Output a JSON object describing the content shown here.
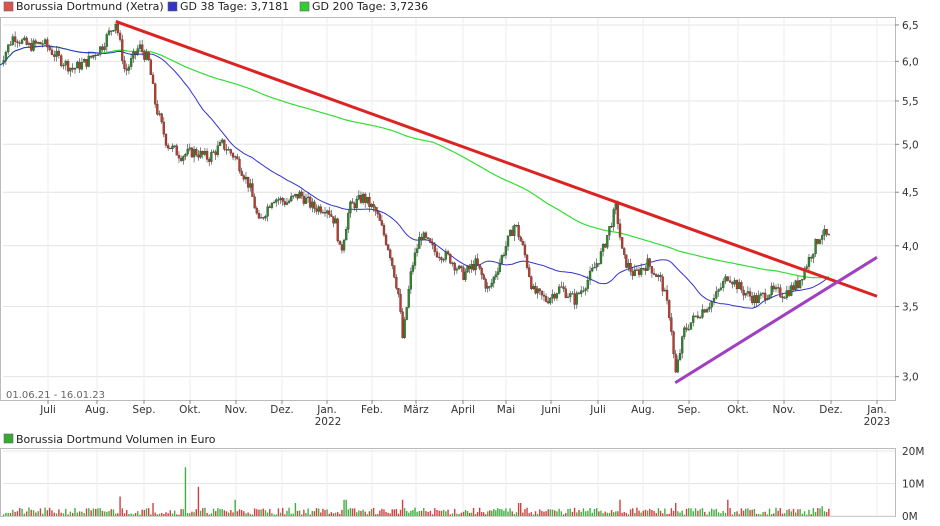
{
  "chart_data": [
    {
      "type": "candlestick",
      "legend": [
        {
          "name": "Borussia Dortmund (Xetra)",
          "color": "#d9534f"
        },
        {
          "name": "GD 38 Tage: 3,7181",
          "color": "#3333cc"
        },
        {
          "name": "GD 200 Tage: 3,7236",
          "color": "#33cc33"
        }
      ],
      "date_range_label": "01.06.21 - 16.01.23",
      "x_tick_labels": [
        "Juli",
        "Aug.",
        "Sep.",
        "Okt.",
        "Nov.",
        "Dez.",
        "Jan.",
        "Feb.",
        "März",
        "April",
        "Mai",
        "Juni",
        "Juli",
        "Aug.",
        "Sep.",
        "Okt.",
        "Nov.",
        "Dez.",
        "Jan."
      ],
      "year_labels": [
        "2022",
        "2023"
      ],
      "y_tick_labels": [
        "3,0",
        "3,5",
        "4,0",
        "4,5",
        "5,0",
        "5,5",
        "6,0",
        "6,5"
      ],
      "y_ticks": [
        3.0,
        3.5,
        4.0,
        4.5,
        5.0,
        5.5,
        6.0,
        6.5
      ],
      "ylim": [
        2.85,
        6.6
      ],
      "y_scale": "log",
      "price_series": [
        {
          "month": 0.0,
          "close": 5.95
        },
        {
          "month": 0.3,
          "close": 6.35
        },
        {
          "month": 0.6,
          "close": 6.2
        },
        {
          "month": 0.9,
          "close": 6.25
        },
        {
          "month": 1.2,
          "close": 6.05
        },
        {
          "month": 1.5,
          "close": 5.9
        },
        {
          "month": 1.8,
          "close": 6.0
        },
        {
          "month": 2.1,
          "close": 6.2
        },
        {
          "month": 2.4,
          "close": 6.55
        },
        {
          "month": 2.6,
          "close": 5.85
        },
        {
          "month": 2.9,
          "close": 6.2
        },
        {
          "month": 3.1,
          "close": 6.0
        },
        {
          "month": 3.25,
          "close": 5.45
        },
        {
          "month": 3.5,
          "close": 5.0
        },
        {
          "month": 3.8,
          "close": 4.88
        },
        {
          "month": 4.1,
          "close": 4.92
        },
        {
          "month": 4.4,
          "close": 4.85
        },
        {
          "month": 4.7,
          "close": 5.0
        },
        {
          "month": 5.0,
          "close": 4.85
        },
        {
          "month": 5.3,
          "close": 4.55
        },
        {
          "month": 5.5,
          "close": 4.2
        },
        {
          "month": 5.8,
          "close": 4.45
        },
        {
          "month": 6.1,
          "close": 4.4
        },
        {
          "month": 6.4,
          "close": 4.48
        },
        {
          "month": 6.7,
          "close": 4.35
        },
        {
          "month": 7.0,
          "close": 4.35
        },
        {
          "month": 7.2,
          "close": 4.2
        },
        {
          "month": 7.3,
          "close": 3.92
        },
        {
          "month": 7.5,
          "close": 4.35
        },
        {
          "month": 7.8,
          "close": 4.45
        },
        {
          "month": 8.1,
          "close": 4.3
        },
        {
          "month": 8.4,
          "close": 3.95
        },
        {
          "month": 8.6,
          "close": 3.6
        },
        {
          "month": 8.7,
          "close": 3.25
        },
        {
          "month": 8.9,
          "close": 3.8
        },
        {
          "month": 9.1,
          "close": 4.1
        },
        {
          "month": 9.4,
          "close": 3.95
        },
        {
          "month": 9.7,
          "close": 3.9
        },
        {
          "month": 10.0,
          "close": 3.75
        },
        {
          "month": 10.3,
          "close": 3.85
        },
        {
          "month": 10.6,
          "close": 3.62
        },
        {
          "month": 10.9,
          "close": 3.9
        },
        {
          "month": 11.2,
          "close": 4.2
        },
        {
          "month": 11.4,
          "close": 3.95
        },
        {
          "month": 11.6,
          "close": 3.62
        },
        {
          "month": 11.9,
          "close": 3.55
        },
        {
          "month": 12.2,
          "close": 3.65
        },
        {
          "month": 12.5,
          "close": 3.55
        },
        {
          "month": 12.8,
          "close": 3.72
        },
        {
          "month": 13.1,
          "close": 3.95
        },
        {
          "month": 13.4,
          "close": 4.35
        },
        {
          "month": 13.55,
          "close": 3.9
        },
        {
          "month": 13.8,
          "close": 3.75
        },
        {
          "month": 14.1,
          "close": 3.85
        },
        {
          "month": 14.4,
          "close": 3.7
        },
        {
          "month": 14.6,
          "close": 3.4
        },
        {
          "month": 14.7,
          "close": 3.0
        },
        {
          "month": 14.9,
          "close": 3.32
        },
        {
          "month": 15.2,
          "close": 3.45
        },
        {
          "month": 15.5,
          "close": 3.55
        },
        {
          "month": 15.8,
          "close": 3.75
        },
        {
          "month": 16.1,
          "close": 3.62
        },
        {
          "month": 16.4,
          "close": 3.55
        },
        {
          "month": 16.7,
          "close": 3.62
        },
        {
          "month": 17.0,
          "close": 3.6
        },
        {
          "month": 17.3,
          "close": 3.68
        },
        {
          "month": 17.6,
          "close": 3.95
        },
        {
          "month": 17.8,
          "close": 4.12
        },
        {
          "month": 18.0,
          "close": 4.05
        }
      ],
      "trendline_upper": {
        "color": "#dd2222",
        "start": {
          "month": 2.4,
          "value": 6.55
        },
        "end": {
          "month": 19.0,
          "value": 3.58
        }
      },
      "trendline_lower": {
        "color": "#a040c0",
        "start": {
          "month": 14.7,
          "value": 2.96
        },
        "end": {
          "month": 19.0,
          "value": 3.9
        }
      }
    },
    {
      "type": "bar",
      "legend": [
        {
          "name": "Borussia Dortmund Volumen in Euro",
          "color": "#33aa33"
        }
      ],
      "y_tick_labels": [
        "20M",
        "10M",
        "0M"
      ],
      "ylim": [
        0,
        20
      ],
      "volume_peaks": [
        {
          "month": 2.5,
          "value": 6
        },
        {
          "month": 3.2,
          "value": 4
        },
        {
          "month": 3.9,
          "value": 15
        },
        {
          "month": 4.2,
          "value": 9
        },
        {
          "month": 5.0,
          "value": 5
        },
        {
          "month": 6.3,
          "value": 4
        },
        {
          "month": 7.4,
          "value": 5
        },
        {
          "month": 8.7,
          "value": 5
        },
        {
          "month": 11.3,
          "value": 4
        },
        {
          "month": 13.5,
          "value": 5
        },
        {
          "month": 14.7,
          "value": 4
        },
        {
          "month": 15.8,
          "value": 5
        },
        {
          "month": 17.8,
          "value": 3
        }
      ]
    }
  ]
}
